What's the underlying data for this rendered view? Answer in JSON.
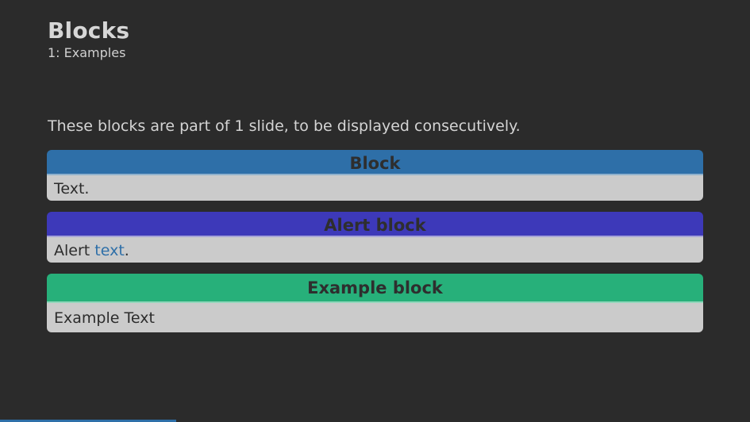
{
  "frame": {
    "title": "Blocks",
    "subtitle": "1: Examples"
  },
  "intro_text": "These blocks are part of 1 slide, to be displayed consecutively.",
  "blocks": {
    "plain": {
      "title": "Block",
      "body": "Text."
    },
    "alert": {
      "title": "Alert block",
      "body_prefix": "Alert ",
      "body_link": "text",
      "body_suffix": "."
    },
    "example": {
      "title": "Example block",
      "body": "Example Text"
    }
  },
  "colors": {
    "background": "#2b2b2b",
    "block_header": "#2e6fa8",
    "alert_header": "#3d39b9",
    "example_header": "#27b07a",
    "block_body": "#cbcbcb",
    "accent_link": "#2e6fa8"
  },
  "progress": {
    "fraction": 0.235
  }
}
